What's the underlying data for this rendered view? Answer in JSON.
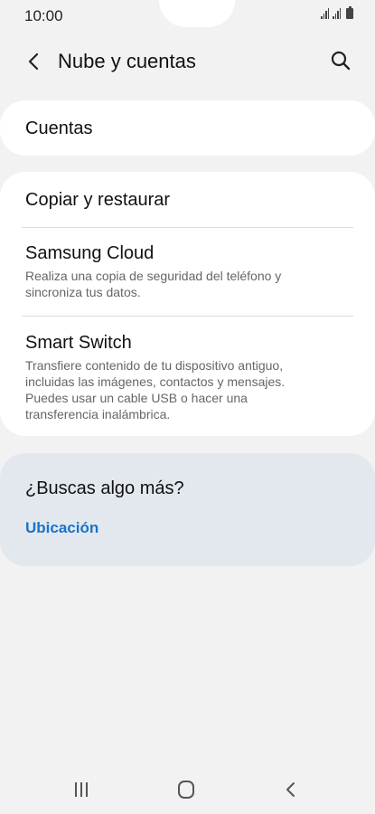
{
  "status_bar": {
    "time": "10:00"
  },
  "header": {
    "title": "Nube y cuentas",
    "back_icon": "chevron-left-icon",
    "search_icon": "search-icon"
  },
  "sections": {
    "accounts": {
      "title": "Cuentas"
    },
    "backup": {
      "items": [
        {
          "title": "Copiar y restaurar"
        },
        {
          "title": "Samsung Cloud",
          "description": "Realiza una copia de seguridad del teléfono y sincroniza tus datos."
        },
        {
          "title": "Smart Switch",
          "description": "Transfiere contenido de tu dispositivo antiguo, incluidas las imágenes, contactos y mensajes. Puedes usar un cable USB o hacer una transferencia inalámbrica."
        }
      ]
    },
    "suggestions": {
      "title": "¿Buscas algo más?",
      "link": "Ubicación"
    }
  },
  "nav_bar": {
    "recents_icon": "recents-icon",
    "home_icon": "home-icon",
    "back_icon": "back-icon"
  },
  "colors": {
    "background": "#f2f2f2",
    "card": "#ffffff",
    "suggestion_card": "#e3e8ee",
    "link": "#1a73c8"
  }
}
